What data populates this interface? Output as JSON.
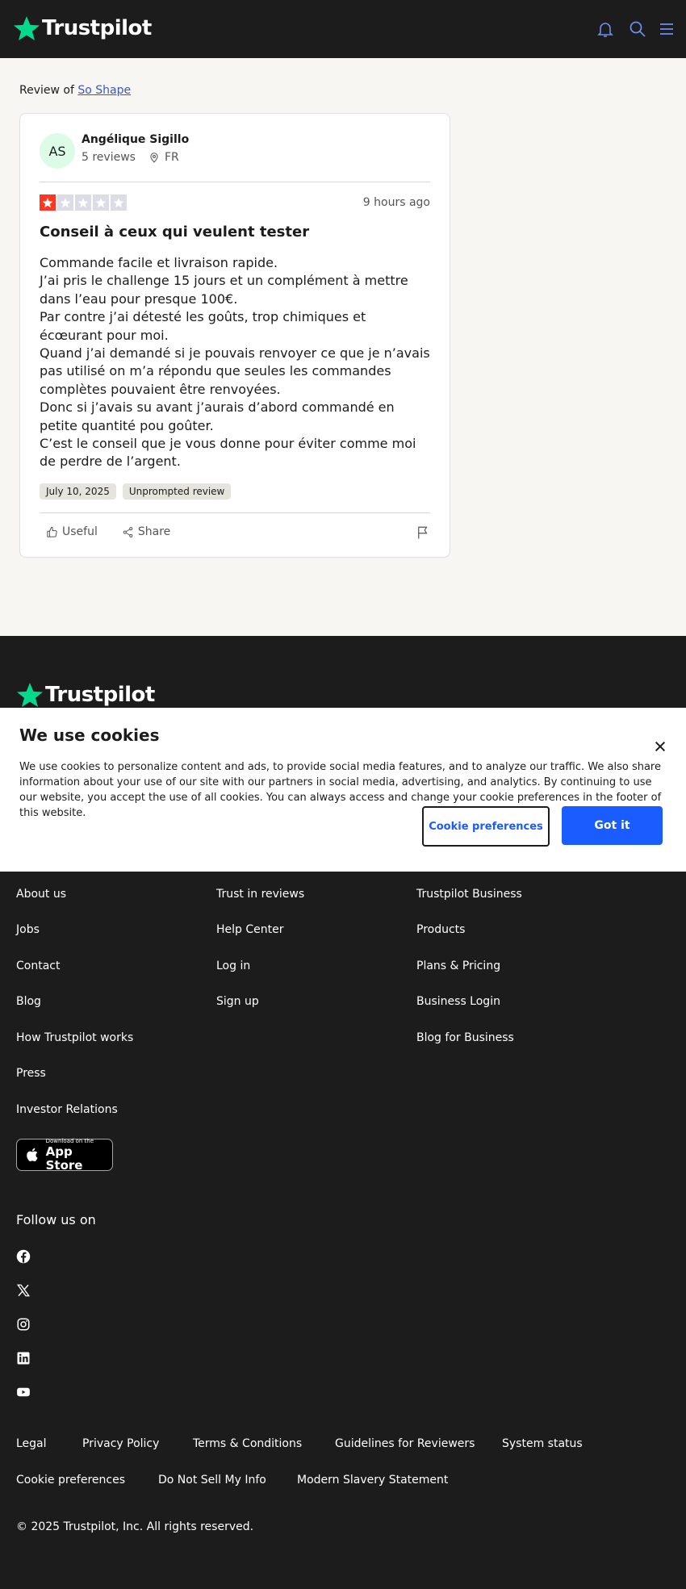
{
  "header": {
    "logo_text": "Trustpilot",
    "icons": [
      "bell-icon",
      "search-icon",
      "menu-icon"
    ],
    "brand_color": "#04da8d",
    "accent_color": "#6e8cf0"
  },
  "breadcrumb": {
    "prefix": "Review of",
    "company": "So Shape"
  },
  "review": {
    "author_initials": "AS",
    "author_name": "Angélique Sigillo",
    "author_reviews": "5 reviews",
    "author_country": "FR",
    "rating": 1,
    "max_rating": 5,
    "rating_color": "#ff3722",
    "time_ago": "9 hours ago",
    "title": "Conseil à ceux qui veulent tester",
    "body_lines": [
      "Commande facile et livraison rapide.",
      "J’ai pris le challenge 15 jours et un complément à mettre dans l’eau pour presque 100€.",
      "Par contre j’ai détesté les goûts, trop chimiques et écœurant pour moi.",
      "Quand j’ai demandé si je pouvais renvoyer ce que je n’avais pas utilisé on m’a répondu que seules les commandes complètes pouvaient être renvoyées.",
      "Donc si j’avais su avant j’aurais d’abord commandé en petite quantité pou goûter.",
      "C’est le conseil que je vous donne pour éviter comme moi de perdre de l’argent."
    ],
    "date_tag": "July 10, 2025",
    "unprompted_tag": "Unprompted review",
    "useful_label": "Useful",
    "share_label": "Share"
  },
  "cookie_banner": {
    "title": "We use cookies",
    "text": "We use cookies to personalize content and ads, to provide social media features, and to analyze our traffic. We also share information about your use of our site with our partners in social media, advertising, and analytics. By continuing to use our website, you accept the use of all cookies. You can always access and change your cookie preferences in the footer of this website.",
    "preferences_label": "Cookie preferences",
    "accept_label": "Got it",
    "accept_color": "#1a5cff"
  },
  "footer": {
    "logo_text": "Trustpilot",
    "col1": [
      "About us",
      "Jobs",
      "Contact",
      "Blog",
      "How Trustpilot works",
      "Press",
      "Investor Relations"
    ],
    "col2": [
      "Trust in reviews",
      "Help Center",
      "Log in",
      "Sign up"
    ],
    "col3": [
      "Trustpilot Business",
      "Products",
      "Plans & Pricing",
      "Business Login",
      "Blog for Business"
    ],
    "app_store_small": "Download on the",
    "app_store_large": "App Store",
    "follow_label": "Follow us on",
    "social_icons": [
      "facebook-icon",
      "x-icon",
      "instagram-icon",
      "linkedin-icon",
      "youtube-icon"
    ],
    "legal_row1": [
      "Legal",
      "Privacy Policy",
      "Terms & Conditions",
      "Guidelines for Reviewers",
      "System status"
    ],
    "legal_row2": [
      "Cookie preferences",
      "Do Not Sell My Info",
      "Modern Slavery Statement"
    ],
    "copyright": "© 2025 Trustpilot, Inc. All rights reserved."
  }
}
